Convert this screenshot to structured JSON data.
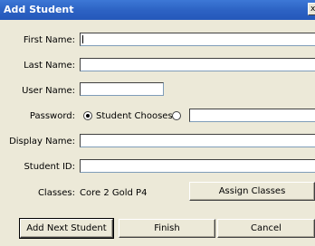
{
  "window": {
    "title": "Add Student",
    "close_glyph": "x"
  },
  "form": {
    "first_name_label": "First Name:",
    "last_name_label": "Last Name:",
    "user_name_label": "User Name:",
    "password_label": "Password:",
    "password_option_student_chooses": "Student Chooses",
    "display_name_label": "Display Name:",
    "student_id_label": "Student ID:",
    "classes_label": "Classes:",
    "classes_value": "Core 2 Gold P4",
    "assign_classes_button": "Assign Classes"
  },
  "buttons": {
    "add_next_student": "Add Next Student",
    "finish": "Finish",
    "cancel": "Cancel"
  }
}
